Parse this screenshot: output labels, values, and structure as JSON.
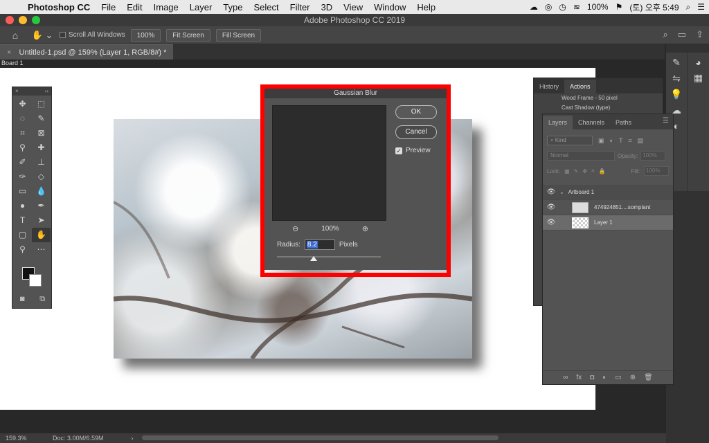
{
  "menubar": {
    "app_name": "Photoshop CC",
    "items": [
      "File",
      "Edit",
      "Image",
      "Layer",
      "Type",
      "Select",
      "Filter",
      "3D",
      "View",
      "Window",
      "Help"
    ],
    "battery": "100%",
    "clock": "(토) 오후 5:49"
  },
  "window": {
    "title": "Adobe Photoshop CC 2019"
  },
  "options": {
    "scroll_all": "Scroll All Windows",
    "zoom_btn": "100%",
    "fit_btn": "Fit Screen",
    "fill_btn": "Fill Screen"
  },
  "document": {
    "tab_title": "Untitled-1.psd @ 159% (Layer 1, RGB/8#) *",
    "artboard_label": "Board 1"
  },
  "dialog": {
    "title": "Gaussian Blur",
    "ok": "OK",
    "cancel": "Cancel",
    "preview": "Preview",
    "preview_checked": true,
    "zoom": "100%",
    "radius_label": "Radius:",
    "radius_value": "8.2",
    "radius_unit": "Pixels"
  },
  "history_panel": {
    "tabs": [
      "History",
      "Actions"
    ],
    "rows": [
      "Wood Frame - 50 pixel",
      "Cast Shadow (type)"
    ]
  },
  "layers_panel": {
    "tabs": [
      "Layers",
      "Channels",
      "Paths"
    ],
    "filter_kind": "Kind",
    "blend_mode": "Normal",
    "opacity_label": "Opacity:",
    "opacity_value": "100%",
    "lock_label": "Lock:",
    "fill_label": "Fill:",
    "fill_value": "100%",
    "layers": [
      {
        "name": "Artboard 1",
        "type": "artboard"
      },
      {
        "name": "474924851....somplant",
        "type": "image"
      },
      {
        "name": "Layer 1",
        "type": "layer",
        "selected": true
      }
    ]
  },
  "status": {
    "zoom": "159.3%",
    "doc": "Doc: 3.00M/6.59M"
  }
}
